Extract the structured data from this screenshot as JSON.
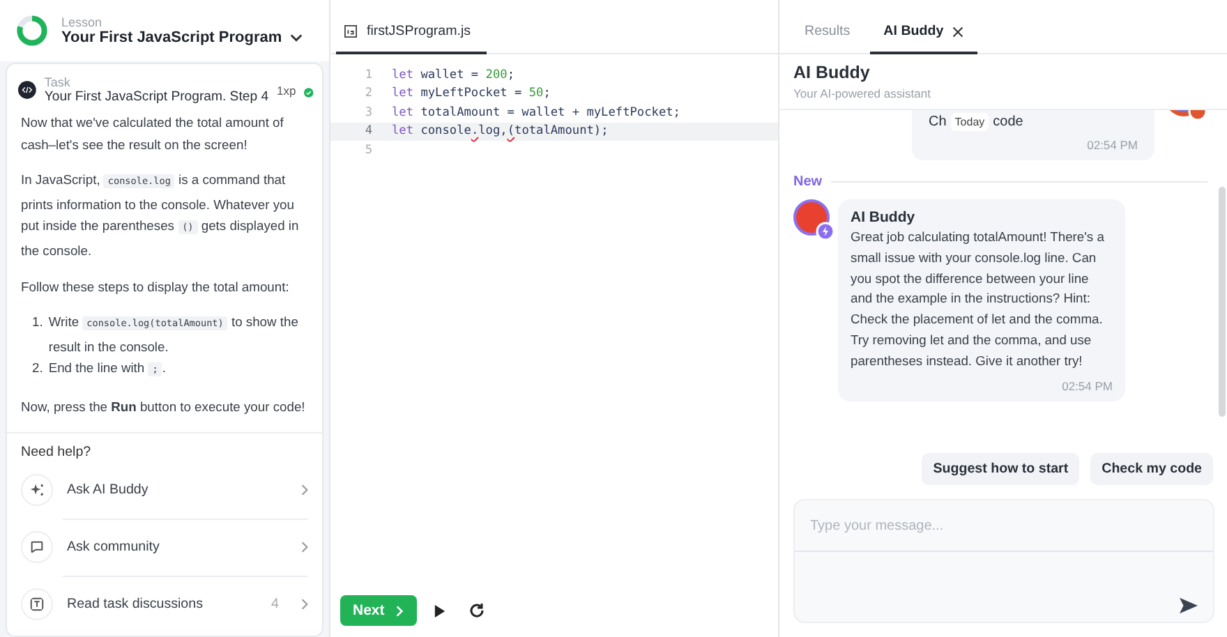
{
  "lesson": {
    "label": "Lesson",
    "title": "Your First JavaScript Program"
  },
  "task": {
    "label": "Task",
    "title": "Your First JavaScript Program. Step 4",
    "xp": "1xp",
    "completed": true,
    "paragraphs": [
      {
        "kind": "para",
        "parts": [
          {
            "kind": "text",
            "text": "Now that we've calculated the total amount of cash–let's see the result on the screen!"
          }
        ]
      },
      {
        "kind": "para",
        "parts": [
          {
            "kind": "text",
            "text": "In JavaScript, "
          },
          {
            "kind": "code",
            "text": "console.log"
          },
          {
            "kind": "text",
            "text": " is a command that prints information to the console. Whatever you put inside the parentheses "
          },
          {
            "kind": "code",
            "text": "()"
          },
          {
            "kind": "text",
            "text": " gets displayed in the console."
          }
        ]
      },
      {
        "kind": "para",
        "parts": [
          {
            "kind": "text",
            "text": "Follow these steps to display the total amount:"
          }
        ]
      },
      {
        "kind": "list",
        "items": [
          {
            "marker": "1.",
            "parts": [
              {
                "kind": "text",
                "text": "Write "
              },
              {
                "kind": "code",
                "text": "console.log(totalAmount)"
              },
              {
                "kind": "text",
                "text": " to show the result in the console."
              }
            ]
          },
          {
            "marker": "2.",
            "parts": [
              {
                "kind": "text",
                "text": "End the line with "
              },
              {
                "kind": "code",
                "text": ";"
              },
              {
                "kind": "text",
                "text": "."
              }
            ]
          }
        ]
      },
      {
        "kind": "para",
        "parts": [
          {
            "kind": "text",
            "text": "Now, press the **Run** button to execute your code!"
          }
        ]
      }
    ]
  },
  "help": {
    "title": "Need help?",
    "items": [
      {
        "label": "Ask AI Buddy"
      },
      {
        "label": "Ask community"
      },
      {
        "label": "Read task discussions",
        "count": "4"
      }
    ]
  },
  "editor": {
    "tab": "firstJSProgram.js",
    "lines": [
      {
        "number": "1",
        "active": false,
        "tokens": [
          {
            "kind": "kw",
            "text": "let"
          },
          {
            "kind": "id",
            "text": " wallet = "
          },
          {
            "kind": "num",
            "text": "200"
          },
          {
            "kind": "id",
            "text": ";"
          }
        ]
      },
      {
        "number": "2",
        "active": false,
        "tokens": [
          {
            "kind": "kw",
            "text": "let"
          },
          {
            "kind": "id",
            "text": " myLeftPocket = "
          },
          {
            "kind": "num",
            "text": "50"
          },
          {
            "kind": "id",
            "text": ";"
          }
        ]
      },
      {
        "number": "3",
        "active": false,
        "tokens": [
          {
            "kind": "kw",
            "text": "let"
          },
          {
            "kind": "id",
            "text": " totalAmount = wallet + myLeftPocket;"
          }
        ]
      },
      {
        "number": "4",
        "active": true,
        "tokens": [
          {
            "kind": "kw",
            "text": "let"
          },
          {
            "kind": "id",
            "text": " console"
          },
          {
            "kind": "err",
            "text": "."
          },
          {
            "kind": "id",
            "text": "log,"
          },
          {
            "kind": "err",
            "text": "("
          },
          {
            "kind": "id",
            "text": "totalAmount);"
          }
        ]
      },
      {
        "number": "5",
        "active": false
      }
    ]
  },
  "toolbar": {
    "next": "Next"
  },
  "right_tabs": [
    {
      "label": "Results",
      "selected": false,
      "closable": false
    },
    {
      "label": "AI Buddy",
      "selected": true,
      "closable": true
    }
  ],
  "assistant": {
    "title": "AI Buddy",
    "subtitle": "Your AI-powered assistant"
  },
  "previous_message": {
    "text_start": "Ch",
    "text_end": "code",
    "time": "02:54 PM",
    "date_badge": "Today"
  },
  "divider": "New",
  "message": {
    "author": "AI Buddy",
    "text": "Great job calculating totalAmount! There's a small issue with your console.log line. Can you spot the difference between your line and the example in the instructions? Hint: Check the placement of let and the comma. Try removing let and the comma, and use parentheses instead. Give it another try!",
    "time": "02:54 PM"
  },
  "suggestions": [
    "Suggest how to start",
    "Check my code"
  ],
  "input": {
    "placeholder": "Type your message..."
  }
}
